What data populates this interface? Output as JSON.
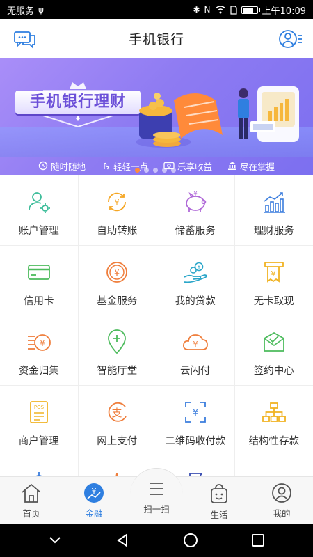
{
  "status_bar": {
    "carrier": "无服务",
    "carrier_extra": "ψ",
    "time": "上午10:09"
  },
  "header": {
    "title": "手机银行",
    "left_icon": "chat-bubbles-icon",
    "right_icon": "user-menu-icon"
  },
  "banner": {
    "title": "手机银行理财",
    "tags": [
      {
        "label": "随时随地",
        "icon": "clock-icon"
      },
      {
        "label": "轻轻一点",
        "icon": "tap-icon"
      },
      {
        "label": "乐享收益",
        "icon": "money-icon"
      },
      {
        "label": "尽在掌握",
        "icon": "bank-icon"
      }
    ],
    "dots": 5,
    "active_dot": 0
  },
  "services": [
    {
      "label": "账户管理",
      "icon": "user-gear-icon"
    },
    {
      "label": "自助转账",
      "icon": "yuan-transfer-icon"
    },
    {
      "label": "储蓄服务",
      "icon": "piggy-bank-icon"
    },
    {
      "label": "理财服务",
      "icon": "bar-chart-icon"
    },
    {
      "label": "信用卡",
      "icon": "credit-card-icon"
    },
    {
      "label": "基金服务",
      "icon": "yuan-coin-icon"
    },
    {
      "label": "我的贷款",
      "icon": "hand-coins-icon"
    },
    {
      "label": "无卡取现",
      "icon": "cash-receipt-icon"
    },
    {
      "label": "资金归集",
      "icon": "coins-stack-icon"
    },
    {
      "label": "智能厅堂",
      "icon": "location-pin-icon"
    },
    {
      "label": "云闪付",
      "icon": "cloud-yuan-icon"
    },
    {
      "label": "签约中心",
      "icon": "envelope-check-icon"
    },
    {
      "label": "商户管理",
      "icon": "pos-receipt-icon"
    },
    {
      "label": "网上支付",
      "icon": "alipay-icon"
    },
    {
      "label": "二维码收付款",
      "icon": "scan-yuan-icon"
    },
    {
      "label": "结构性存款",
      "icon": "org-chart-icon"
    },
    {
      "label": "",
      "icon": "gear-icon"
    },
    {
      "label": "",
      "icon": "spark-icon"
    },
    {
      "label": "",
      "icon": "flag-icon"
    },
    {
      "label": "",
      "icon": "blank"
    }
  ],
  "bottom_nav": [
    {
      "label": "首页",
      "icon": "home-icon",
      "active": false
    },
    {
      "label": "金融",
      "icon": "finance-icon",
      "active": true
    },
    {
      "label": "扫一扫",
      "icon": "scan-icon",
      "active": false
    },
    {
      "label": "生活",
      "icon": "life-icon",
      "active": false
    },
    {
      "label": "我的",
      "icon": "profile-icon",
      "active": false
    }
  ],
  "colors": {
    "accent": "#2f7fe0",
    "banner_dot_active": "#ff8a3a"
  }
}
